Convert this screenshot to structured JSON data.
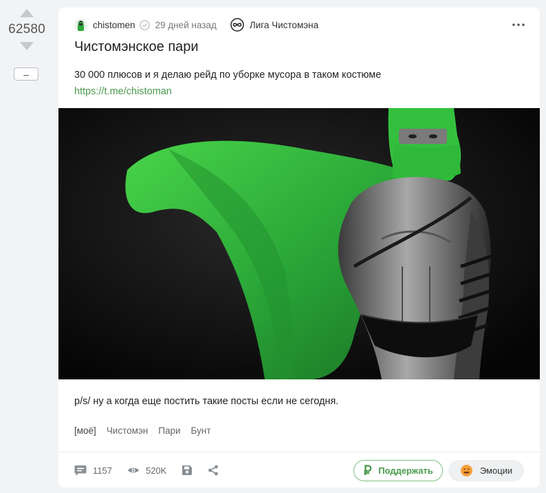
{
  "rating": {
    "value": "62580",
    "collapse_label": "–"
  },
  "post": {
    "author": "chistomen",
    "time": "29 дней назад",
    "community": "Лига Чистомэна",
    "title": "Чистомэнское пари",
    "text": "30 000 плюсов и я делаю рейд по уборке мусора в таком костюме",
    "link": "https://t.me/chistoman",
    "postscript": "p/s/ ну а когда еще постить такие посты если не сегодня.",
    "tags": [
      "[моё]",
      "Чистомэн",
      "Пари",
      "Бунт"
    ]
  },
  "footer": {
    "comments": "1157",
    "views": "520K",
    "support_label": "Поддержать",
    "emotions_label": "Эмоции"
  },
  "icons": {
    "upvote": "arrow-up-icon",
    "downvote": "arrow-down-icon",
    "verified": "check-circle-icon",
    "community": "infinity-icon",
    "more": "dots-icon",
    "comments": "comment-icon",
    "views": "eye-icon",
    "save": "floppy-icon",
    "share": "share-icon",
    "support": "ruble-icon",
    "emotions": "emoji-icon"
  },
  "colors": {
    "accent_green": "#4c9a4e",
    "costume_green": "#2fb83a",
    "background": "#f2f3f5"
  }
}
